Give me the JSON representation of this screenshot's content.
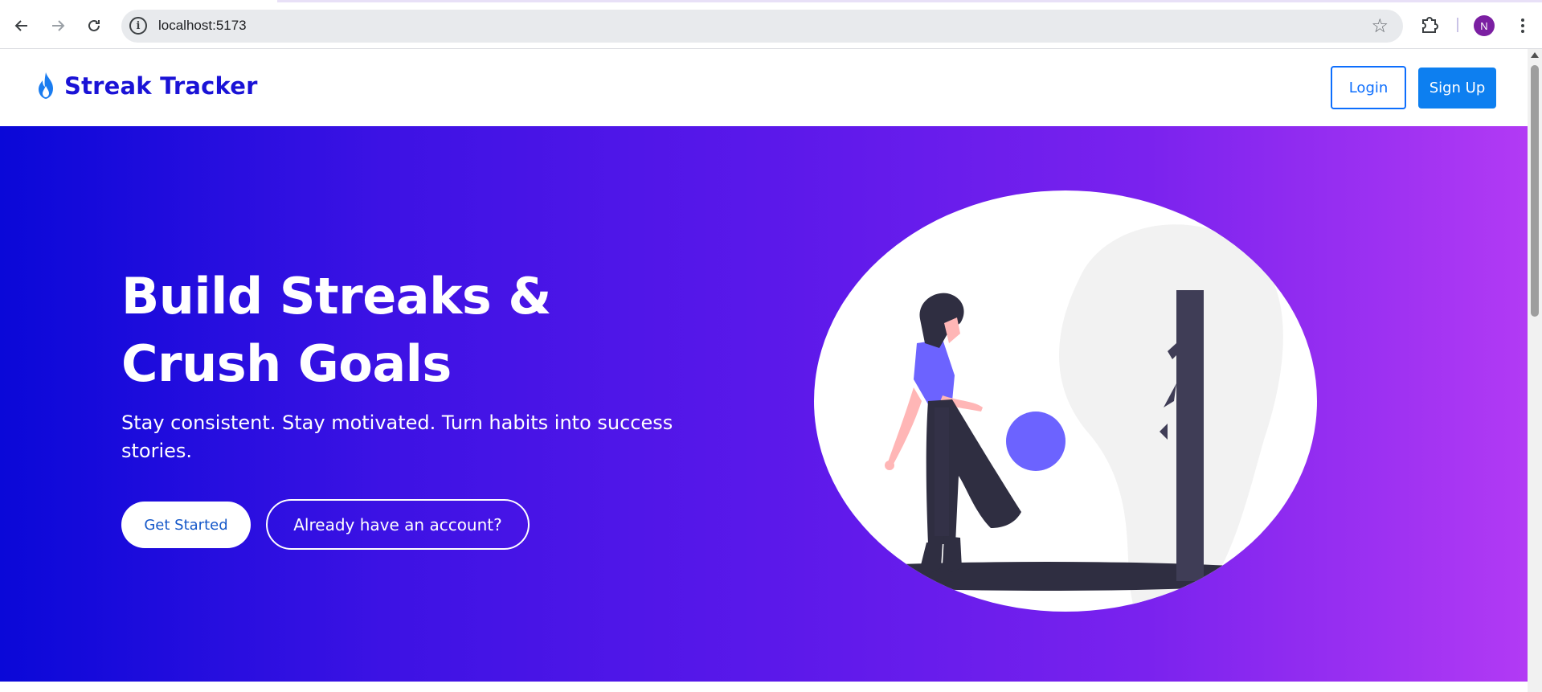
{
  "browser": {
    "url": "localhost:5173",
    "profile_initial": "N",
    "colors": {
      "profile": "#7b1fa2",
      "omnibox": "#e8eaed"
    },
    "icons": [
      "back-arrow-icon",
      "forward-arrow-icon",
      "reload-icon",
      "site-info-icon",
      "bookmark-star-icon",
      "extensions-icon",
      "menu-dots-icon"
    ]
  },
  "navbar": {
    "brand": "Streak Tracker",
    "login_label": "Login",
    "signup_label": "Sign Up",
    "colors": {
      "brand": "#1a12d6",
      "primary": "#0d7ff0"
    }
  },
  "hero": {
    "title_line1": "Build Streaks &",
    "title_line2": "Crush Goals",
    "subtitle": "Stay consistent. Stay motivated. Turn habits into success stories.",
    "get_started_label": "Get Started",
    "account_label": "Already have an account?",
    "gradient": [
      "#0a08d8",
      "#b23af4"
    ]
  }
}
